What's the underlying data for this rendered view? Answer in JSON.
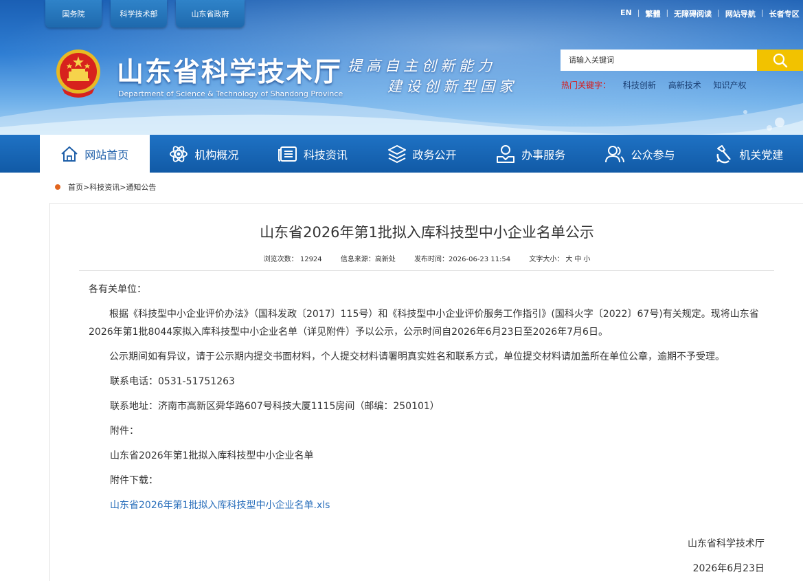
{
  "gov_links": [
    "国务院",
    "科学技术部",
    "山东省政府"
  ],
  "top_links": [
    "EN",
    "繁體",
    "无障碍阅读",
    "网站导航",
    "长者专区"
  ],
  "site": {
    "title": "山东省科学技术厅",
    "subtitle": "Department of Science & Technology of Shandong Province",
    "slogan_line1": "提高自主创新能力",
    "slogan_line2": "建设创新型国家"
  },
  "search": {
    "placeholder": "请输入关键词",
    "hot_label": "热门关键字：",
    "hot_keywords": [
      "科技创新",
      "高新技术",
      "知识产权"
    ]
  },
  "nav": [
    {
      "label": "网站首页",
      "icon": "home-icon"
    },
    {
      "label": "机构概况",
      "icon": "atom-icon"
    },
    {
      "label": "科技资讯",
      "icon": "news-icon"
    },
    {
      "label": "政务公开",
      "icon": "layers-icon"
    },
    {
      "label": "办事服务",
      "icon": "service-icon"
    },
    {
      "label": "公众参与",
      "icon": "people-icon"
    },
    {
      "label": "机关党建",
      "icon": "party-icon"
    }
  ],
  "breadcrumb": [
    "首页",
    "科技资讯",
    "通知公告"
  ],
  "article": {
    "title": "山东省2026年第1批拟入库科技型中小企业名单公示",
    "views_label": "浏览次数：",
    "views": "12924",
    "source_label": "信息来源：",
    "source": "高新处",
    "date_label": "发布时间：",
    "date": "2026-06-23 11:54",
    "font_label": "文字大小：",
    "font_sizes": [
      "大",
      "中",
      "小"
    ],
    "greeting": "各有关单位：",
    "para1": "根据《科技型中小企业评价办法》（国科发政〔2017〕115号）和《科技型中小企业评价服务工作指引》(国科火字〔2022〕67号)有关规定。现将山东省2026年第1批8044家拟入库科技型中小企业名单（详见附件）予以公示，公示时间自2026年6月23日至2026年7月6日。",
    "para2": "公示期间如有异议，请于公示期内提交书面材料，个人提交材料请署明真实姓名和联系方式，单位提交材料请加盖所在单位公章，逾期不予受理。",
    "phone_line": "联系电话：0531-51751263",
    "address_line": "联系地址：济南市高新区舜华路607号科技大厦1115房间（邮编：250101）",
    "attachment_label": "附件：",
    "attachment_name": "山东省2026年第1批拟入库科技型中小企业名单",
    "download_label": "附件下载：",
    "download_link": "山东省2026年第1批拟入库科技型中小企业名单.xls",
    "signature": "山东省科学技术厅",
    "sign_date": "2026年6月23日"
  },
  "colors": {
    "nav_blue": "#1668b8",
    "link_blue": "#2a6fbb",
    "hot_red": "#d61c1c",
    "search_yellow": "#f2c200",
    "crumb_dot": "#e2651e"
  }
}
